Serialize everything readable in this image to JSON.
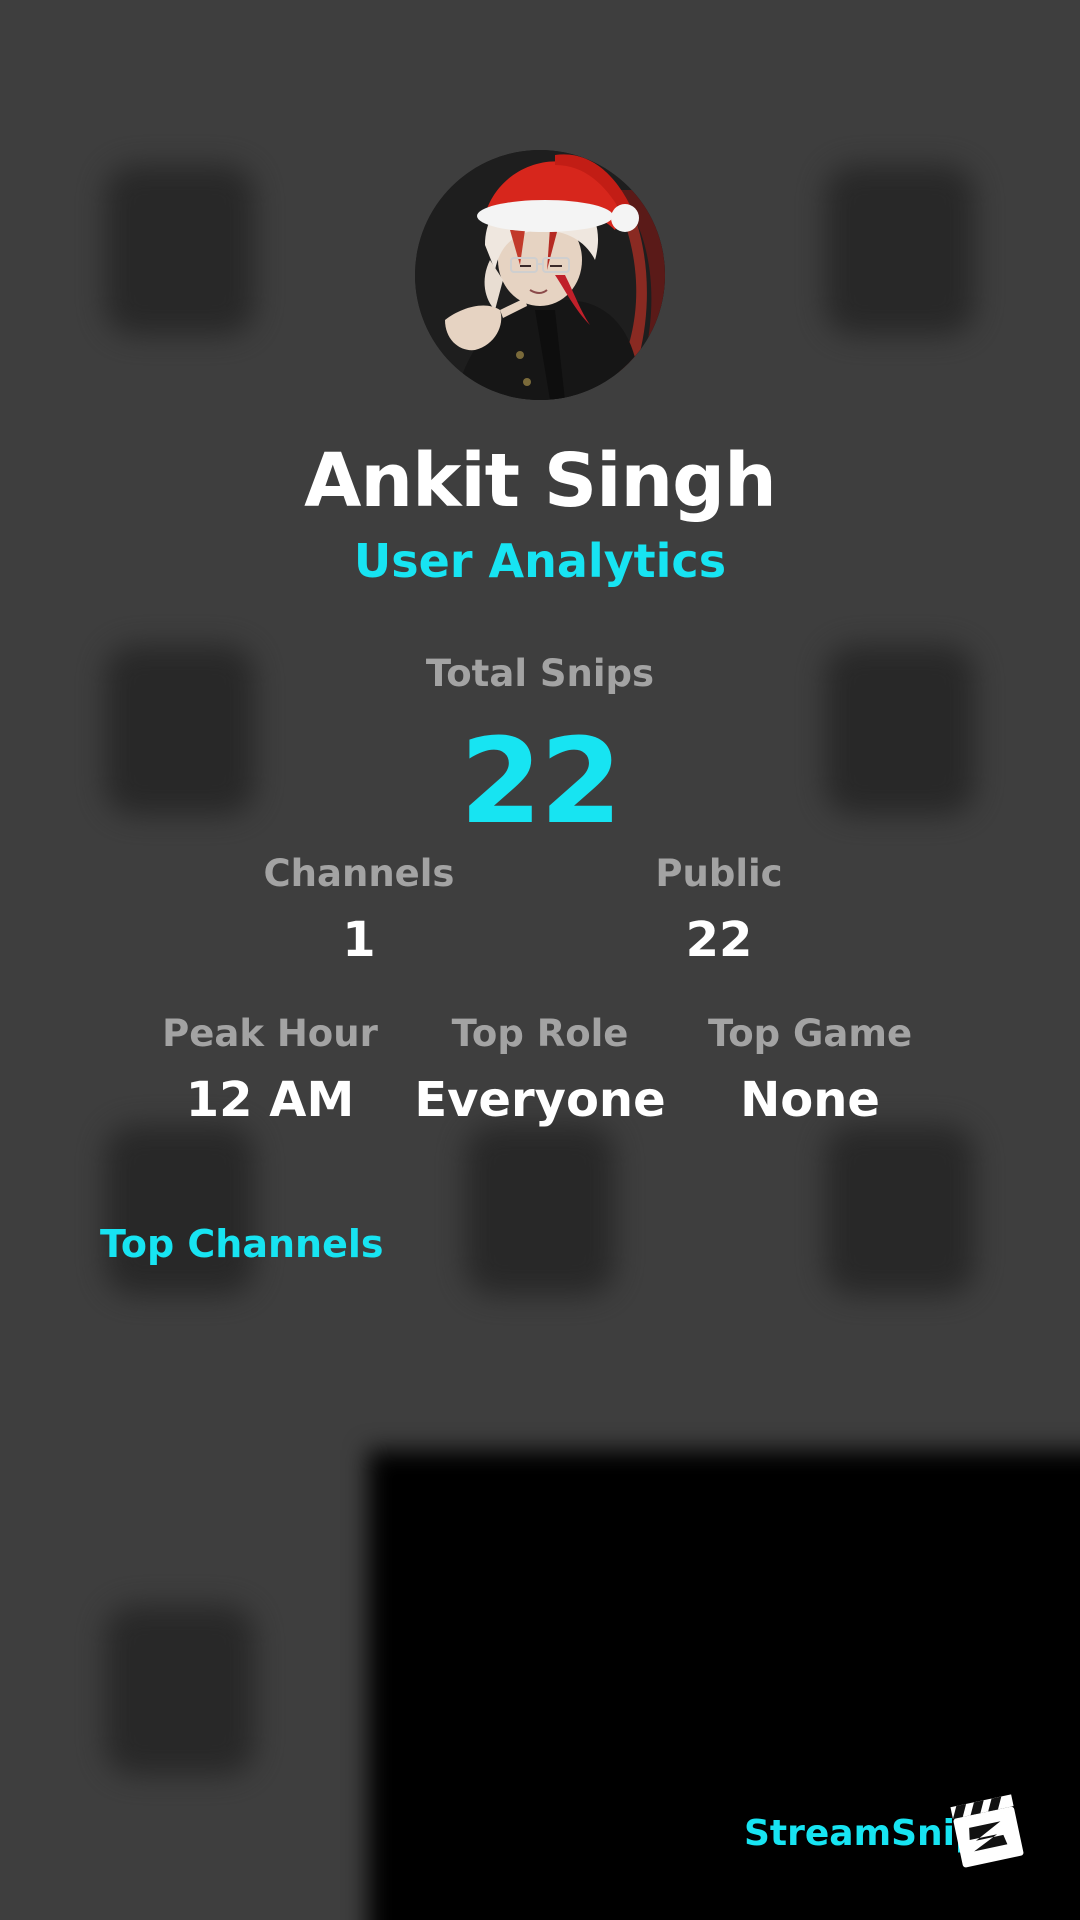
{
  "profile": {
    "name": "Ankit Singh",
    "subtitle": "User Analytics",
    "avatar_icon": "user-avatar-santa-hat"
  },
  "stats": {
    "total_snips_label": "Total Snips",
    "total_snips_value": "22",
    "channels_label": "Channels",
    "channels_value": "1",
    "public_label": "Public",
    "public_value": "22",
    "peak_hour_label": "Peak Hour",
    "peak_hour_value": "12 AM",
    "top_role_label": "Top Role",
    "top_role_value": "Everyone",
    "top_game_label": "Top Game",
    "top_game_value": "None"
  },
  "sections": {
    "top_channels_title": "Top Channels"
  },
  "brand": {
    "name": "StreamSnip",
    "logo_icon": "clapperboard-icon"
  },
  "colors": {
    "accent": "#17e4f2",
    "background": "#3e3e3e",
    "label": "#a3a3a3",
    "text": "#ffffff"
  }
}
